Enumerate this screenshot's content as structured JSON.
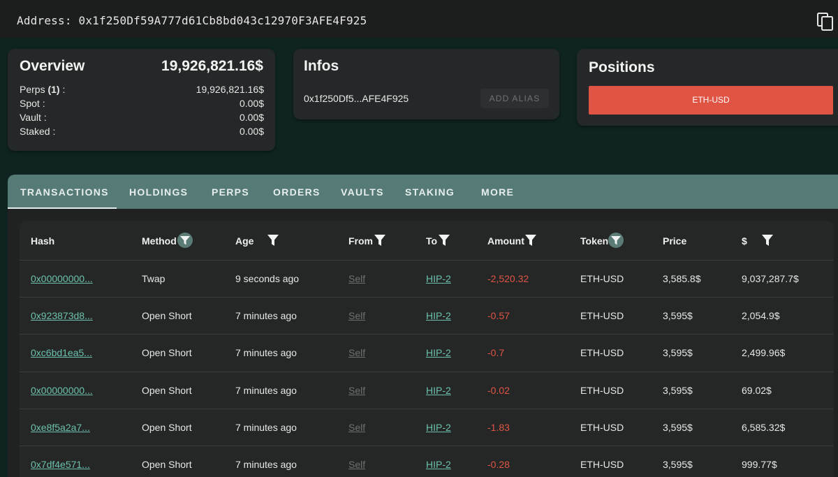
{
  "header": {
    "address_label": "Address: 0x1f250Df59A777d61Cb8bd043c12970F3AFE4F925",
    "copy_icon": "copy-icon"
  },
  "overview": {
    "title": "Overview",
    "total": "19,926,821.16$",
    "rows": [
      {
        "label": "Perps",
        "count": "(1)",
        "suffix": " :",
        "value": "19,926,821.16$"
      },
      {
        "label": "Spot :",
        "value": "0.00$"
      },
      {
        "label": "Vault :",
        "value": "0.00$"
      },
      {
        "label": "Staked :",
        "value": "0.00$"
      }
    ]
  },
  "infos": {
    "title": "Infos",
    "address_short": "0x1f250Df5...AFE4F925",
    "add_alias_label": "ADD ALIAS"
  },
  "positions": {
    "title": "Positions",
    "items": [
      "ETH-USD"
    ],
    "item_color": "#e05444"
  },
  "tabs": [
    "TRANSACTIONS",
    "HOLDINGS",
    "PERPS",
    "ORDERS",
    "VAULTS",
    "STAKING",
    "MORE"
  ],
  "active_tab": "TRANSACTIONS",
  "table": {
    "columns": [
      "Hash",
      "Method",
      "Age",
      "From",
      "To",
      "Amount",
      "Token",
      "Price",
      "$"
    ],
    "filterable": [
      "Method",
      "Age",
      "From",
      "To",
      "Amount",
      "Token",
      "$"
    ],
    "rows": [
      {
        "hash": "0x00000000...",
        "method": "Twap",
        "age": "9 seconds ago",
        "from": "Self",
        "to": "HIP-2",
        "amount": "-2,520.32",
        "token": "ETH-USD",
        "price": "3,585.8$",
        "usd": "9,037,287.7$"
      },
      {
        "hash": "0x923873d8...",
        "method": "Open Short",
        "age": "7 minutes ago",
        "from": "Self",
        "to": "HIP-2",
        "amount": "-0.57",
        "token": "ETH-USD",
        "price": "3,595$",
        "usd": "2,054.9$"
      },
      {
        "hash": "0xc6bd1ea5...",
        "method": "Open Short",
        "age": "7 minutes ago",
        "from": "Self",
        "to": "HIP-2",
        "amount": "-0.7",
        "token": "ETH-USD",
        "price": "3,595$",
        "usd": "2,499.96$"
      },
      {
        "hash": "0x00000000...",
        "method": "Open Short",
        "age": "7 minutes ago",
        "from": "Self",
        "to": "HIP-2",
        "amount": "-0.02",
        "token": "ETH-USD",
        "price": "3,595$",
        "usd": "69.02$"
      },
      {
        "hash": "0xe8f5a2a7...",
        "method": "Open Short",
        "age": "7 minutes ago",
        "from": "Self",
        "to": "HIP-2",
        "amount": "-1.83",
        "token": "ETH-USD",
        "price": "3,595$",
        "usd": "6,585.32$"
      },
      {
        "hash": "0x7df4e571...",
        "method": "Open Short",
        "age": "7 minutes ago",
        "from": "Self",
        "to": "HIP-2",
        "amount": "-0.28",
        "token": "ETH-USD",
        "price": "3,595$",
        "usd": "999.77$"
      }
    ]
  },
  "colors": {
    "background": "#0f2420",
    "card": "#252828",
    "tab_bar": "#567a75",
    "link": "#6cc0ad",
    "negative": "#e05444"
  }
}
